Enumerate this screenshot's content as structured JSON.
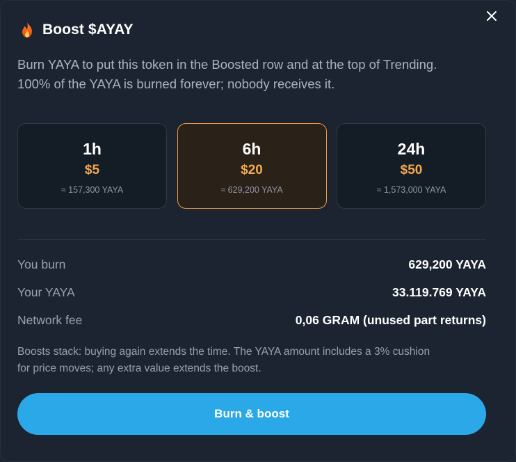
{
  "modal": {
    "title": "Boost $AYAY",
    "description": "Burn YAYA to put this token in the Boosted row and at the top of Trending.\n100% of the YAYA is burned forever; nobody receives it.",
    "icons": {
      "title": "flame-icon",
      "close": "close-icon"
    }
  },
  "options": [
    {
      "duration": "1h",
      "price": "$5",
      "amount": "≈ 157,300 YAYA",
      "selected": false
    },
    {
      "duration": "6h",
      "price": "$20",
      "amount": "≈ 629,200 YAYA",
      "selected": true
    },
    {
      "duration": "24h",
      "price": "$50",
      "amount": "≈ 1,573,000 YAYA",
      "selected": false
    }
  ],
  "summary": {
    "you_burn": {
      "label": "You burn",
      "value": "629,200 YAYA"
    },
    "your_yaya": {
      "label": "Your YAYA",
      "value": "33.119.769 YAYA"
    },
    "network_fee": {
      "label": "Network fee",
      "value": "0,06 GRAM (unused part returns)"
    }
  },
  "note": "Boosts stack: buying again extends the time. The YAYA amount includes a 3% cushion\nfor price moves; any extra value extends the boost.",
  "cta": {
    "label": "Burn & boost"
  },
  "colors": {
    "background": "#1b2430",
    "accent": "#2aa8e8",
    "selected_border": "#e79a44",
    "price": "#f6a94f"
  }
}
